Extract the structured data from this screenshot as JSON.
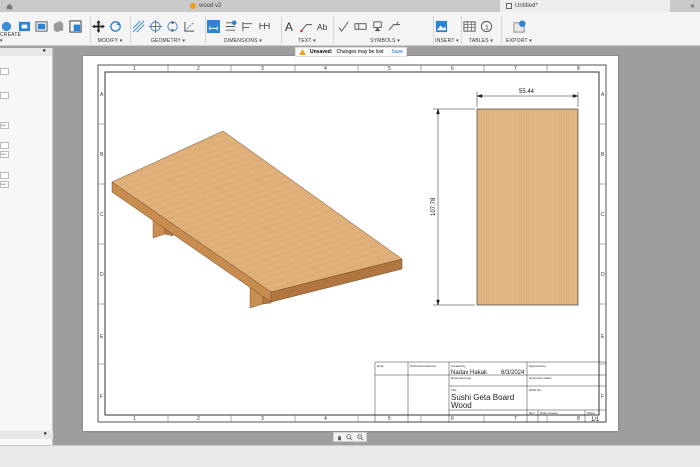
{
  "tabs": [
    {
      "label": "wood v2",
      "active": false
    },
    {
      "label": "Untitled*",
      "active": true
    }
  ],
  "ribbon": {
    "groups": [
      {
        "label": "CREATE ▾",
        "icons": [
          "sketch-icon",
          "base-view-icon",
          "projected-view-icon",
          "section-view-icon",
          "detail-view-icon"
        ]
      },
      {
        "label": "MODIFY ▾",
        "icons": [
          "move-icon",
          "rotate-icon"
        ]
      },
      {
        "label": "GEOMETRY ▾",
        "icons": [
          "centerline-icon",
          "center-mark-icon",
          "center-pattern-icon",
          "edge-extension-icon"
        ]
      },
      {
        "label": "DIMENSIONS ▾",
        "icons": [
          "dimension-icon",
          "ordinate-icon",
          "baseline-icon",
          "chain-icon"
        ]
      },
      {
        "label": "TEXT ▾",
        "icons": [
          "text-icon",
          "leader-icon",
          "note-icon"
        ]
      },
      {
        "label": "SYMBOLS ▾",
        "icons": [
          "surface-texture-icon",
          "feature-control-frame-icon",
          "datum-icon",
          "weld-icon"
        ]
      },
      {
        "label": "INSERT ▾",
        "icons": [
          "insert-image-icon"
        ]
      },
      {
        "label": "TABLES ▾",
        "icons": [
          "table-icon",
          "balloon-icon"
        ]
      },
      {
        "label": "EXPORT ▾",
        "icons": [
          "export-icon"
        ]
      }
    ]
  },
  "left_panel": {
    "chips": [
      "nes",
      "nes",
      "nes"
    ]
  },
  "notice": {
    "title": "Unsaved:",
    "message": "Changes may be lost",
    "save_label": "Save"
  },
  "sheet": {
    "col_labels": [
      "1",
      "2",
      "3",
      "4",
      "5",
      "6",
      "7",
      "8"
    ],
    "row_labels": [
      "A",
      "B",
      "C",
      "D",
      "E",
      "F"
    ],
    "dimension_width": "55.44",
    "dimension_height": "107.78",
    "title_block": {
      "dept_label": "Dept.",
      "tech_ref_label": "Technical reference",
      "created_by_label": "Created by",
      "created_by": "Nadav Hakak",
      "date": "6/3/2024",
      "approved_by_label": "Approved by",
      "doc_type_label": "Document type",
      "doc_status_label": "Document status",
      "dwg_no_label": "DWG No.",
      "title_label": "Title",
      "title_line1": "Sushi Geta Board",
      "title_line2": "Wood",
      "rev_label": "Rev.",
      "date_of_issue_label": "Date of issue",
      "sheet_label": "Sheet",
      "sheet_value": "1/1"
    }
  },
  "colors": {
    "wood_top": "#e2b27c",
    "wood_side": "#c78c4e",
    "wood_dark": "#a76f3a",
    "accent": "#0a6fd6"
  }
}
